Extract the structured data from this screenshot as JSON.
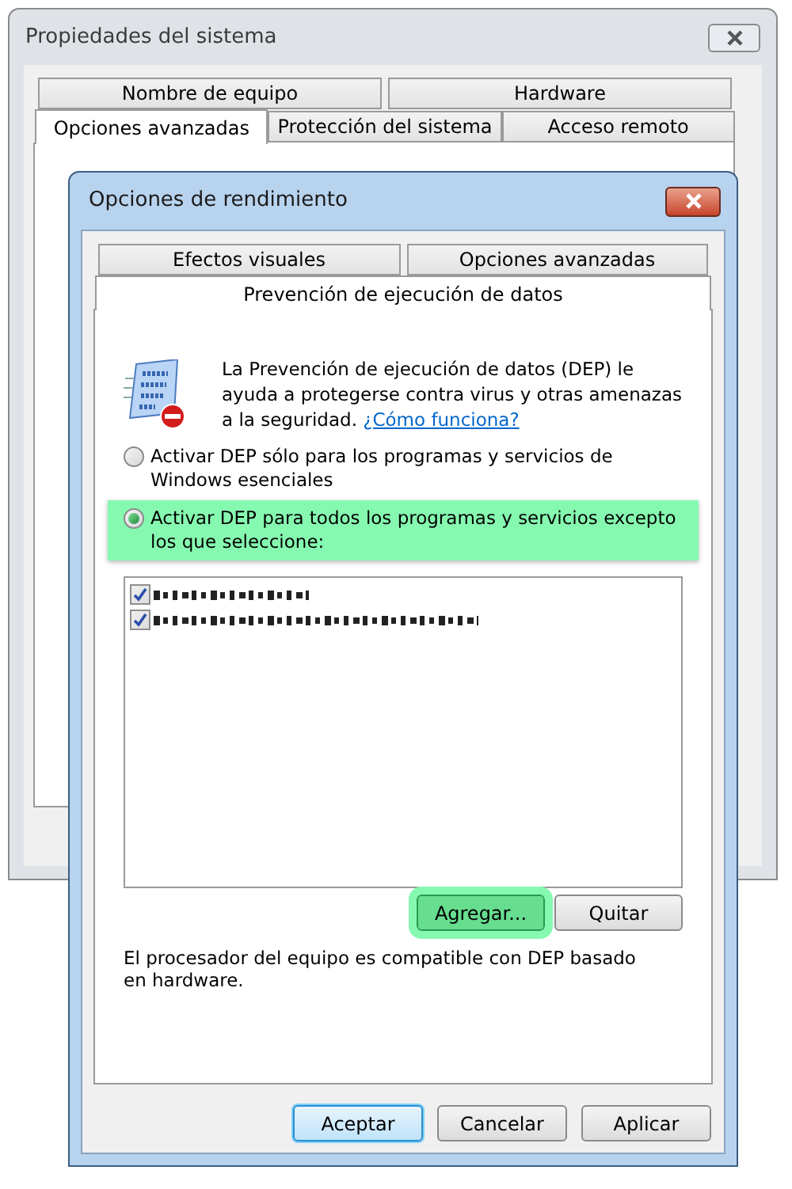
{
  "outer_window": {
    "title": "Propiedades del sistema",
    "tab_rows": [
      [
        {
          "label": "Nombre de equipo",
          "selected": false
        },
        {
          "label": "Hardware",
          "selected": false
        }
      ],
      [
        {
          "label": "Opciones avanzadas",
          "selected": true
        },
        {
          "label": "Protección del sistema",
          "selected": false
        },
        {
          "label": "Acceso remoto",
          "selected": false
        }
      ]
    ]
  },
  "dialog": {
    "title": "Opciones de rendimiento",
    "tab_rows": [
      [
        {
          "label": "Efectos visuales",
          "selected": false
        },
        {
          "label": "Opciones avanzadas",
          "selected": false
        }
      ],
      [
        {
          "label": "Prevención de ejecución de datos",
          "selected": true
        }
      ]
    ],
    "description": "La Prevención de ejecución de datos (DEP) le ayuda a protegerse contra virus y otras amenazas a la seguridad.",
    "help_link": "¿Cómo funciona?",
    "options": [
      {
        "label": "Activar DEP sólo para los programas y servicios de Windows esenciales",
        "selected": false,
        "highlighted": false
      },
      {
        "label": "Activar DEP para todos los programas y servicios excepto los que seleccione:",
        "selected": true,
        "highlighted": true
      }
    ],
    "exceptions": [
      {
        "checked": true
      },
      {
        "checked": true
      }
    ],
    "list_buttons": [
      {
        "label": "Agregar...",
        "highlighted": true
      },
      {
        "label": "Quitar",
        "highlighted": false
      }
    ],
    "note": "El procesador del equipo es compatible con DEP basado en hardware.",
    "buttons": [
      {
        "label": "Aceptar",
        "default": true
      },
      {
        "label": "Cancelar",
        "default": false
      },
      {
        "label": "Aplicar",
        "default": false
      }
    ]
  }
}
